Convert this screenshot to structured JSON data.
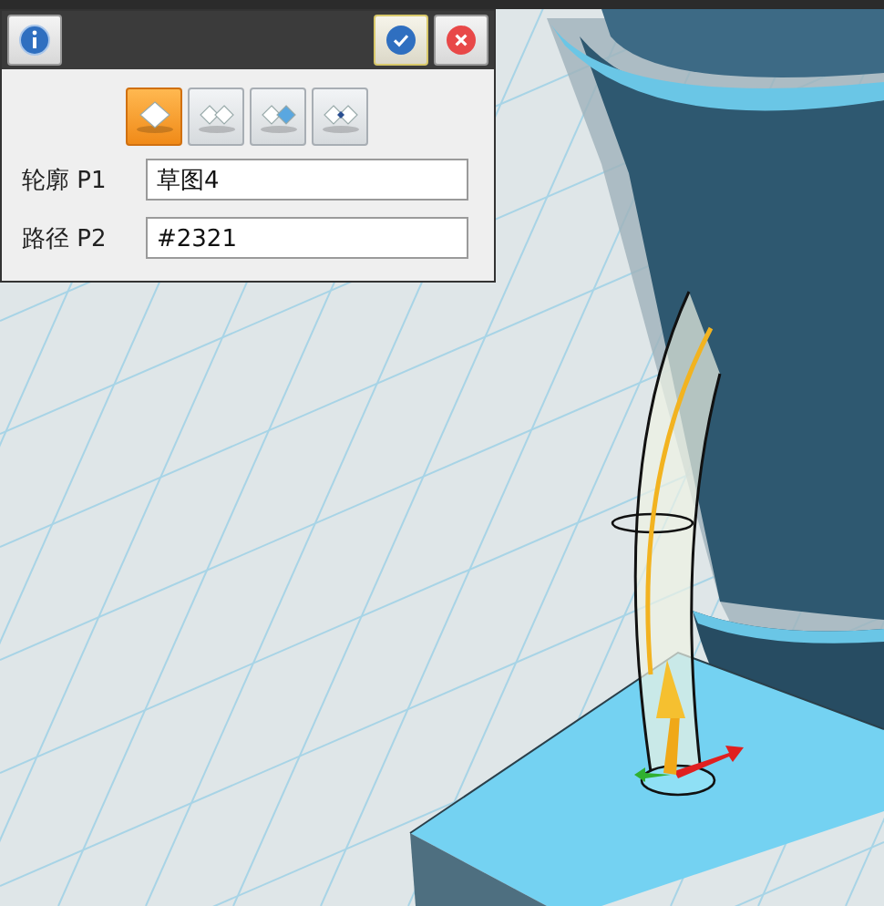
{
  "panel": {
    "mode_buttons": [
      {
        "selected": true
      },
      {
        "selected": false
      },
      {
        "selected": false
      },
      {
        "selected": false
      }
    ],
    "fields": [
      {
        "label": "轮廓 P1",
        "value": "草图4"
      },
      {
        "label": "路径 P2",
        "value": "#2321"
      }
    ]
  }
}
